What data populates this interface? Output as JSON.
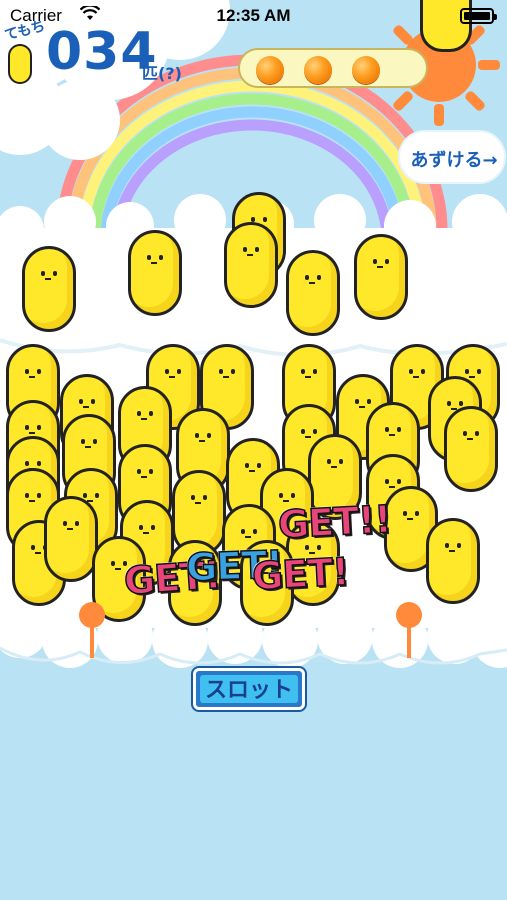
{
  "status_bar": {
    "carrier": "Carrier",
    "time": "12:35 AM"
  },
  "counter": {
    "label": "てもち",
    "value": "034",
    "unit": "匹(?)"
  },
  "balls": {
    "count": 3,
    "color": "#ff9a1a"
  },
  "deposit_button": {
    "label": "あずける→"
  },
  "slot_button": {
    "label": "スロット"
  },
  "get_effects": [
    "GET!!",
    "GET!",
    "GET!",
    "GET!"
  ],
  "colors": {
    "sky": "#b9e2f4",
    "critter": "#ffe82a",
    "sun": "#ff8a3c",
    "accent": "#1a5fb8"
  }
}
